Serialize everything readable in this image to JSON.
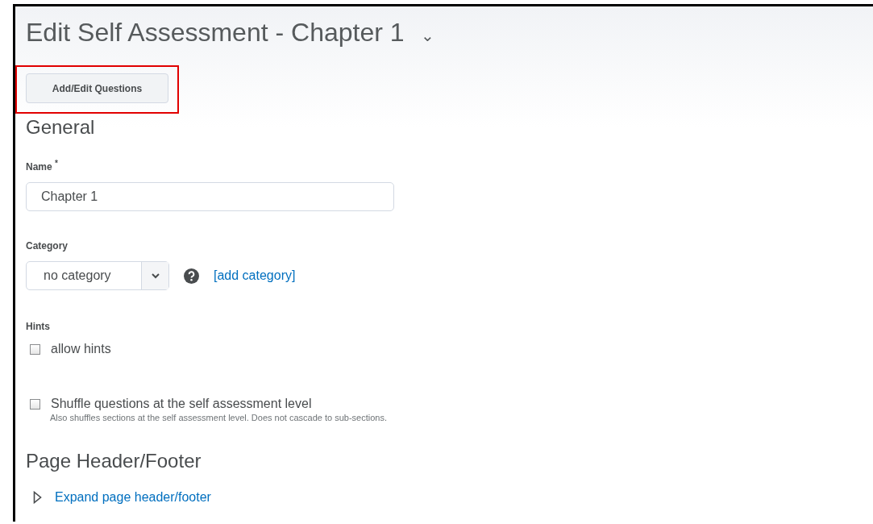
{
  "page": {
    "title": "Edit Self Assessment - Chapter 1",
    "title_menu": "⌄"
  },
  "add_edit_button": {
    "label": "Add/Edit Questions",
    "highlighted": true
  },
  "general": {
    "heading": "General",
    "name_field": {
      "label": "Name",
      "required_mark": "*",
      "value": "Chapter 1"
    },
    "category": {
      "label": "Category",
      "value": "no category",
      "link": "[add category]"
    },
    "hints": {
      "label": "Hints",
      "checkbox": {
        "label": "allow hints",
        "checked": false
      }
    },
    "shuffle": {
      "label": "Shuffle questions at the self assessment level",
      "checked": false,
      "help": "Also shuffles sections at the self assessment level. Does not cascade to sub-sections."
    }
  },
  "header_footer": {
    "heading": "Page Header/Footer",
    "toggle": {
      "label": "Expand page header/footer",
      "expanded": false
    }
  }
}
